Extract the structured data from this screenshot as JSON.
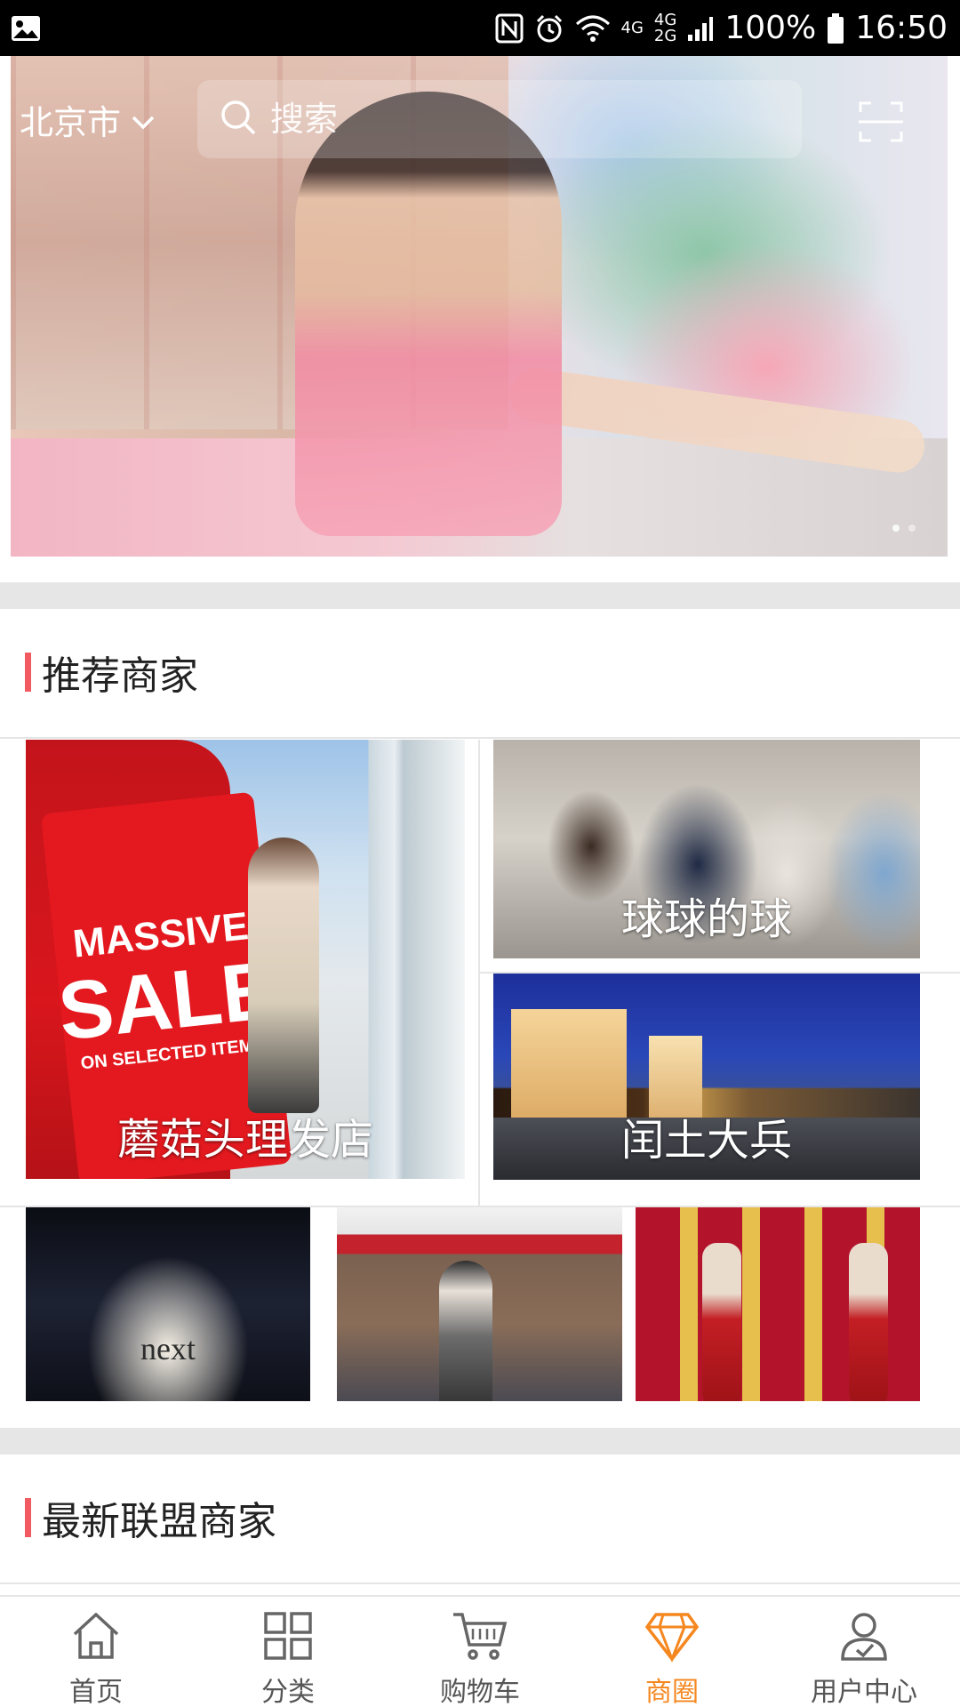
{
  "status_bar": {
    "battery": "100%",
    "time": "16:50",
    "network_1": "4G",
    "network_2": "4G",
    "network_2_sub": "2G"
  },
  "header": {
    "city": "北京市",
    "search_placeholder": "搜索"
  },
  "banner": {
    "page_count": 2,
    "active_index": 0
  },
  "sections": {
    "recommended": {
      "title": "推荐商家",
      "merchants": [
        {
          "name": "蘑菇头理发店",
          "image_text": {
            "line1": "MASSIVE",
            "line2": "SALE",
            "line3": "ON SELECTED ITEMS"
          }
        },
        {
          "name": "球球的球"
        },
        {
          "name": "闰土大兵"
        }
      ],
      "extra_tiles": [
        {
          "image_text": "next"
        },
        {
          "image_text": ""
        },
        {
          "image_text": ""
        }
      ]
    },
    "latest": {
      "title": "最新联盟商家"
    }
  },
  "bottom_nav": {
    "items": [
      {
        "label": "首页",
        "icon": "home-icon",
        "active": false
      },
      {
        "label": "分类",
        "icon": "grid-icon",
        "active": false
      },
      {
        "label": "购物车",
        "icon": "cart-icon",
        "active": false
      },
      {
        "label": "商圈",
        "icon": "diamond-icon",
        "active": true
      },
      {
        "label": "用户中心",
        "icon": "user-icon",
        "active": false
      }
    ],
    "active_color": "#f5871f",
    "inactive_color": "#555555"
  },
  "colors": {
    "accent_bar": "#f15a61",
    "section_gap": "#e6e6e6"
  }
}
